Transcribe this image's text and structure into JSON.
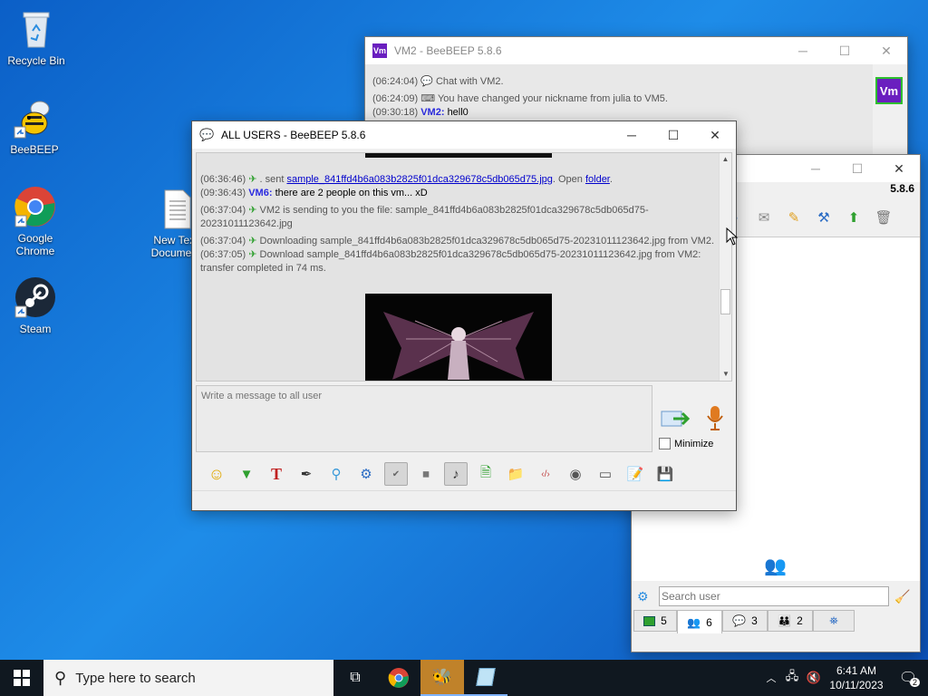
{
  "desktop": {
    "icons": [
      {
        "label": "Recycle Bin"
      },
      {
        "label": "BeeBEEP"
      },
      {
        "label": "Google Chrome"
      },
      {
        "label": "Steam"
      },
      {
        "label": "New Text Document"
      }
    ]
  },
  "vm2_window": {
    "title": "VM2 - BeeBEEP 5.8.6",
    "avatar_text": "Vm",
    "lines": [
      {
        "ts": "(06:24:04)",
        "text": "Chat with VM2."
      },
      {
        "ts": "(06:24:09)",
        "text": "You have changed your nickname from julia to VM5."
      },
      {
        "ts": "(09:30:18)",
        "nick": "VM2:",
        "text": "hell0"
      }
    ]
  },
  "main_window": {
    "version": "5.8.6",
    "search_placeholder": "Search user",
    "tabs": [
      {
        "count": "5"
      },
      {
        "count": "6"
      },
      {
        "count": "3"
      },
      {
        "count": "2"
      },
      {
        "count": ""
      }
    ]
  },
  "all_users_window": {
    "title": "ALL USERS - BeeBEEP 5.8.6",
    "chat": [
      {
        "ts": "(06:36:46)",
        "pre": ". sent ",
        "link": "sample_841ffd4b6a083b2825f01dca329678c5db065d75.jpg",
        "mid": ". Open ",
        "link2": "folder",
        "post": "."
      },
      {
        "ts": "(09:36:43)",
        "nick": "VM6:",
        "text": "there are 2 people on this vm... xD"
      },
      {
        "ts": "(06:37:04)",
        "text": "VM2 is sending to you the file: sample_841ffd4b6a083b2825f01dca329678c5db065d75-20231011123642.jpg"
      },
      {
        "ts": "(06:37:04)",
        "text": "Downloading sample_841ffd4b6a083b2825f01dca329678c5db065d75-20231011123642.jpg from VM2."
      },
      {
        "ts": "(06:37:05)",
        "text": "Download sample_841ffd4b6a083b2825f01dca329678c5db065d75-20231011123642.jpg from VM2: transfer completed in 74 ms."
      }
    ],
    "input_placeholder": "Write a message to all user",
    "minimize_label": "Minimize"
  },
  "taskbar": {
    "search_placeholder": "Type here to search",
    "time": "6:41 AM",
    "date": "10/11/2023",
    "notification_count": "2"
  }
}
